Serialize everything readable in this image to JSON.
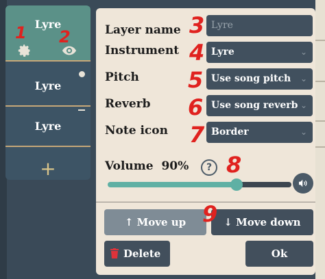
{
  "layers": [
    {
      "label": "Lyre"
    },
    {
      "label": "Lyre"
    },
    {
      "label": "Lyre"
    }
  ],
  "add_symbol": "+",
  "annotations": [
    "1",
    "2",
    "3",
    "4",
    "5",
    "6",
    "7",
    "8",
    "9"
  ],
  "dialog": {
    "layer_name": {
      "label": "Layer name",
      "placeholder": "Lyre"
    },
    "instrument": {
      "label": "Instrument",
      "value": "Lyre"
    },
    "pitch": {
      "label": "Pitch",
      "value": "Use song pitch"
    },
    "reverb": {
      "label": "Reverb",
      "value": "Use song reverb"
    },
    "note_icon": {
      "label": "Note icon",
      "value": "Border"
    },
    "volume": {
      "label": "Volume",
      "percent_text": "90%",
      "value": 0.9
    },
    "help_symbol": "?",
    "buttons": {
      "move_up": "↑ Move up",
      "move_down": "↓ Move down",
      "delete": "Delete",
      "ok": "Ok"
    }
  },
  "colors": {
    "accent": "#5fb0a4",
    "annotation": "#e0221f",
    "dialog_bg": "#efe6d9",
    "field_bg": "#41505e"
  }
}
